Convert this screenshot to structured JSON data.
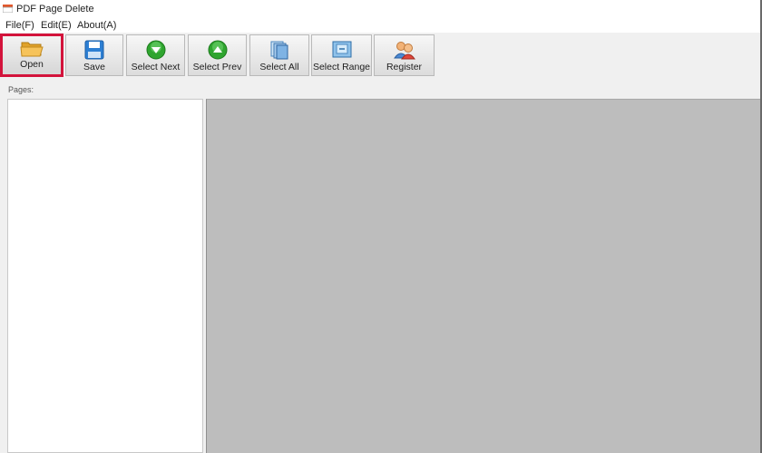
{
  "window": {
    "title": "PDF Page Delete"
  },
  "menu": {
    "items": [
      {
        "label": "File(F)"
      },
      {
        "label": "Edit(E)"
      },
      {
        "label": "About(A)"
      }
    ]
  },
  "toolbar": {
    "buttons": [
      {
        "label": "Open",
        "icon": "folder-icon",
        "selected": true
      },
      {
        "label": "Save",
        "icon": "floppy-disk-icon"
      },
      {
        "label": "Select Next",
        "icon": "green-arrow-down-icon"
      },
      {
        "label": "Select Prev",
        "icon": "green-arrow-up-icon"
      },
      {
        "label": "Select All",
        "icon": "stacked-pages-icon"
      },
      {
        "label": "Select Range",
        "icon": "page-range-icon"
      },
      {
        "label": "Register",
        "icon": "users-icon"
      }
    ]
  },
  "pages_panel": {
    "label": "Pages:"
  },
  "colors": {
    "highlight_border": "#d3133b",
    "preview_background": "#bdbdbd",
    "arrow_green": "#2fa52f"
  }
}
